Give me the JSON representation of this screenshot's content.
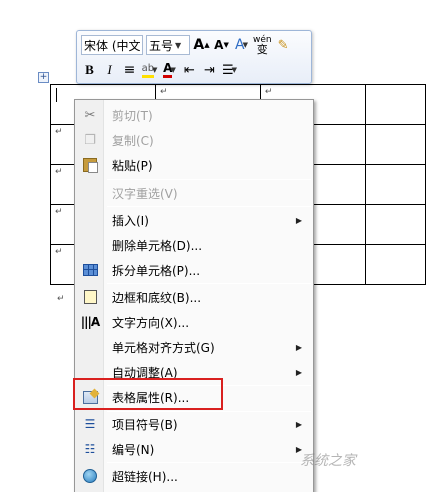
{
  "mini_toolbar": {
    "font_name": "宋体 (中文",
    "font_size": "五号",
    "grow_font": "A",
    "shrink_font": "A",
    "styles": "A",
    "phonetic": "wén",
    "bold": "B",
    "italic": "I",
    "center": "≡",
    "font_color": "A"
  },
  "table_marks": [
    "↵",
    "↵",
    "↵",
    "↵",
    "↵"
  ],
  "para_mark": "↵",
  "context_menu": {
    "items": [
      {
        "label": "剪切(T)",
        "disabled": true
      },
      {
        "label": "复制(C)",
        "disabled": true
      },
      {
        "label": "粘贴(P)",
        "disabled": false
      },
      {
        "label": "汉字重选(V)",
        "disabled": true
      },
      {
        "label": "插入(I)",
        "disabled": false,
        "submenu": true
      },
      {
        "label": "删除单元格(D)...",
        "disabled": false
      },
      {
        "label": "拆分单元格(P)...",
        "disabled": false
      },
      {
        "label": "边框和底纹(B)...",
        "disabled": false
      },
      {
        "label": "文字方向(X)...",
        "disabled": false
      },
      {
        "label": "单元格对齐方式(G)",
        "disabled": false,
        "submenu": true
      },
      {
        "label": "自动调整(A)",
        "disabled": false,
        "submenu": true
      },
      {
        "label": "表格属性(R)...",
        "disabled": false,
        "highlighted": true
      },
      {
        "label": "项目符号(B)",
        "disabled": false,
        "submenu": true
      },
      {
        "label": "编号(N)",
        "disabled": false,
        "submenu": true
      },
      {
        "label": "超链接(H)...",
        "disabled": false
      }
    ],
    "submenu_arrow": "▶"
  },
  "watermark": "系统之家",
  "colors": {
    "highlight_border": "#d9201f",
    "font_color_red": "#d00000",
    "highlight_yellow": "#ffe000"
  }
}
